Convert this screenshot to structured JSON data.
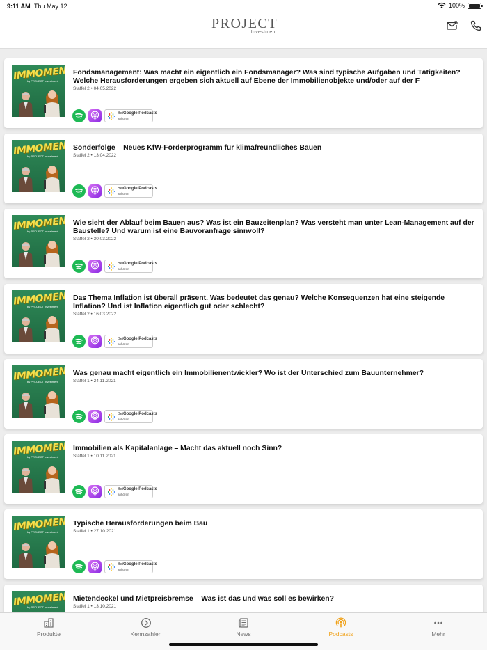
{
  "status_bar": {
    "time": "9:11 AM",
    "date": "Thu May 12",
    "battery": "100%"
  },
  "header": {
    "logo_main": "PROJECT",
    "logo_sub": "Investment",
    "mail_icon": "mail-icon",
    "phone_icon": "phone-icon"
  },
  "thumbnail": {
    "word": "IMMOMENT",
    "subline": "by PROJECT Investment"
  },
  "badges": {
    "google_top_prefix": "Bei",
    "google_brand": "Google Podcasts",
    "google_bottom": "anhören"
  },
  "episodes": [
    {
      "title": "Fondsmanagement: Was macht ein eigentlich ein Fondsmanager? Was sind typische Aufgaben und Tätigkeiten? Welche Herausforderungen ergeben sich aktuell auf Ebene der Immobilienobjekte und/oder auf der F",
      "meta": "Staffel 2 • 04.05.2022"
    },
    {
      "title": "Sonderfolge – Neues KfW-Förderprogramm für klimafreundliches Bauen",
      "meta": "Staffel 2 • 13.04.2022"
    },
    {
      "title": "Wie sieht der Ablauf beim Bauen aus? Was ist ein Bauzeitenplan? Was versteht man unter Lean-Management auf der Baustelle? Und warum ist eine Bauvoranfrage sinnvoll?",
      "meta": "Staffel 2 • 30.03.2022"
    },
    {
      "title": "Das Thema Inflation ist überall präsent. Was bedeutet das genau? Welche Konsequenzen hat eine steigende Inflation? Und ist Inflation eigentlich gut oder schlecht?",
      "meta": "Staffel 2 • 16.03.2022"
    },
    {
      "title": "Was genau macht eigentlich ein Immobilienentwickler? Wo ist der Unterschied zum Bauunternehmer?",
      "meta": "Staffel 1 • 24.11.2021"
    },
    {
      "title": "Immobilien als Kapitalanlage – Macht das aktuell noch Sinn?",
      "meta": "Staffel 1 • 10.11.2021"
    },
    {
      "title": "Typische Herausforderungen beim Bau",
      "meta": "Staffel 1 • 27.10.2021"
    },
    {
      "title": "Mietendeckel und Mietpreisbremse – Was ist das und was soll es bewirken?",
      "meta": "Staffel 1 • 13.10.2021"
    }
  ],
  "tabs": [
    {
      "label": "Produkte",
      "icon": "building-icon",
      "active": false
    },
    {
      "label": "Kennzahlen",
      "icon": "chart-circle-icon",
      "active": false
    },
    {
      "label": "News",
      "icon": "newspaper-icon",
      "active": false
    },
    {
      "label": "Podcasts",
      "icon": "podcast-icon",
      "active": true
    },
    {
      "label": "Mehr",
      "icon": "more-icon",
      "active": false
    }
  ],
  "colors": {
    "accent": "#f0a21a",
    "spotify": "#1DB954",
    "apple_podcasts": "#a24de8"
  }
}
